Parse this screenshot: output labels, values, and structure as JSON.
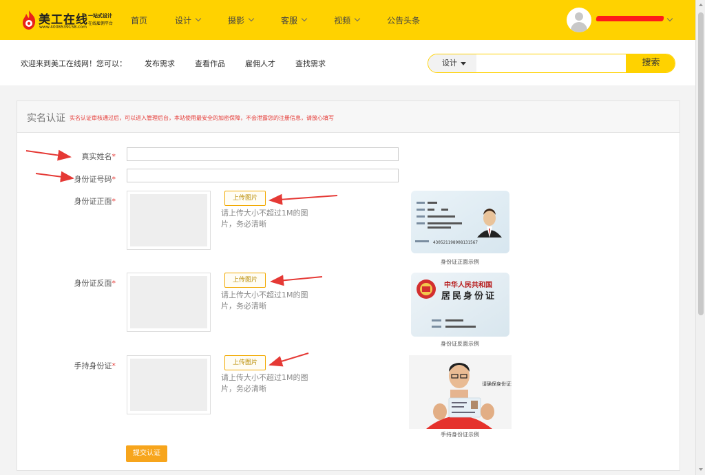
{
  "header": {
    "logo_brand": "美工在线",
    "logo_phone": "www.4008539158.com",
    "logo_slogan_1": "一站式设计",
    "logo_slogan_2": "在线雇佣平台",
    "nav": [
      {
        "label": "首页",
        "has_dropdown": false
      },
      {
        "label": "设计",
        "has_dropdown": true
      },
      {
        "label": "摄影",
        "has_dropdown": true
      },
      {
        "label": "客服",
        "has_dropdown": true
      },
      {
        "label": "视频",
        "has_dropdown": true
      },
      {
        "label": "公告头条",
        "has_dropdown": false
      }
    ]
  },
  "subheader": {
    "welcome": "欢迎来到美工在线网！您可以：",
    "links": [
      "发布需求",
      "查看作品",
      "雇佣人才",
      "查找需求"
    ],
    "search": {
      "category": "设计",
      "placeholder": "",
      "button": "搜索"
    }
  },
  "form": {
    "title": "实名认证",
    "note": "实名认证审核通过后，可以进入管理后台，本站使用最安全的加密保障，不会泄露您的注册信息，请放心填写",
    "required_mark": "*",
    "name_label": "真实姓名",
    "id_label": "身份证号码",
    "front_label": "身份证正面",
    "back_label": "身份证反面",
    "hold_label": "手持身份证",
    "upload_label": "上传图片",
    "upload_hint": "请上传大小不超过1M的图片，务必清晰",
    "front_caption": "身份证正面示例",
    "back_caption": "身份证反面示例",
    "hold_caption": "手持身份证示例",
    "submit": "提交认证"
  },
  "samples": {
    "front_number": "430521198908131567",
    "back_title": "中华人民共和国",
    "back_subtitle": "居民身份证",
    "hold_note": "请确保身份证清晰"
  },
  "colors": {
    "brand_yellow": "#ffd200",
    "accent_orange": "#f7a51c",
    "annotation_red": "#e53935"
  }
}
